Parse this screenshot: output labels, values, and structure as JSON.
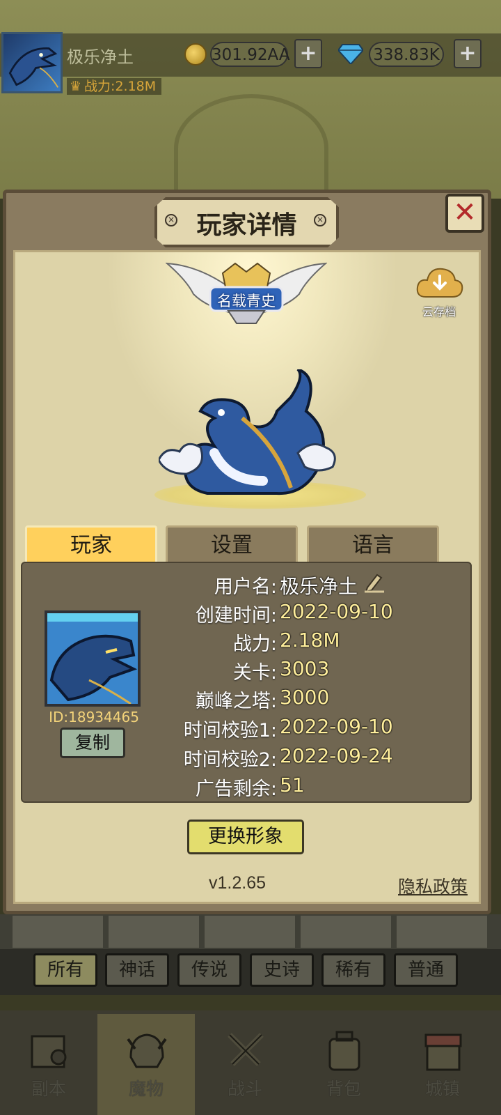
{
  "top_bar": {
    "player_name": "极乐净土",
    "power": "战力:2.18M",
    "gold": "301.92AA",
    "gems": "338.83K",
    "plus": "+"
  },
  "modal": {
    "title": "玩家详情",
    "close": "✕",
    "title_badge": "名载青史",
    "cloud_save": "云存档",
    "tabs": [
      "玩家",
      "设置",
      "语言"
    ],
    "player": {
      "id": "ID:18934465",
      "copy_label": "复制",
      "rows": [
        {
          "label": "用户名:",
          "value": "极乐净土"
        },
        {
          "label": "创建时间:",
          "value": "2022-09-10"
        },
        {
          "label": "战力:",
          "value": "2.18M"
        },
        {
          "label": "关卡:",
          "value": "3003"
        },
        {
          "label": "巅峰之塔:",
          "value": "3000"
        },
        {
          "label": "时间校验1:",
          "value": "2022-09-10"
        },
        {
          "label": "时间校验2:",
          "value": "2022-09-24"
        },
        {
          "label": "广告剩余:",
          "value": "51"
        }
      ]
    },
    "change_avatar": "更换形象",
    "version": "v1.2.65",
    "privacy": "隐私政策"
  },
  "filters": [
    "所有",
    "神话",
    "传说",
    "史诗",
    "稀有",
    "普通"
  ],
  "nav": [
    "副本",
    "魔物",
    "战斗",
    "背包",
    "城镇"
  ]
}
